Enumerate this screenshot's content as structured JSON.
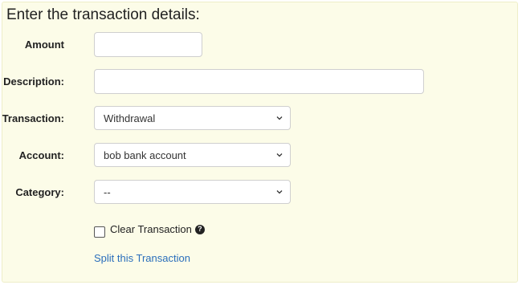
{
  "form": {
    "title": "Enter the transaction details:",
    "amount": {
      "label": "Amount",
      "value": ""
    },
    "description": {
      "label": "Description:",
      "value": ""
    },
    "transaction": {
      "label": "Transaction:",
      "selected": "Withdrawal"
    },
    "account": {
      "label": "Account:",
      "selected": "bob bank account"
    },
    "category": {
      "label": "Category:",
      "selected": "--"
    },
    "clear_transaction": {
      "label": "Clear Transaction",
      "checked": false
    },
    "split_link": "Split this Transaction"
  },
  "colors": {
    "panel_bg": "#fcfce8",
    "link": "#2a6ebb"
  },
  "icons": {
    "select_arrow": "chevron-down-icon",
    "help": "question-circle-icon"
  }
}
